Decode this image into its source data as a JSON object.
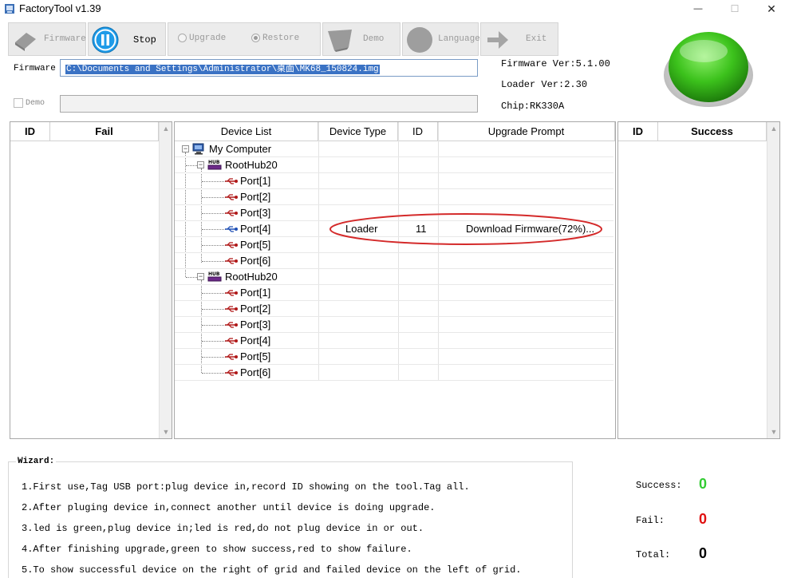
{
  "window": {
    "title": "FactoryTool v1.39",
    "minimize": "—",
    "maximize": "☐",
    "close": "✕"
  },
  "toolbar": {
    "firmware": "Firmware",
    "stop": "Stop",
    "upgrade": "Upgrade",
    "restore": "Restore",
    "demo": "Demo",
    "language": "Language",
    "exit": "Exit"
  },
  "firmware": {
    "label": "Firmware",
    "path": "C:\\Documents and Settings\\Administrator\\桌面\\MK68_150824.img"
  },
  "demo": {
    "label": "Demo",
    "path": ""
  },
  "info": {
    "fw_ver": "Firmware Ver:5.1.00",
    "loader_ver": "Loader Ver:2.30",
    "chip": "Chip:RK330A"
  },
  "status_led": {
    "color": "#3cc21c"
  },
  "fail_grid": {
    "id": "ID",
    "title": "Fail"
  },
  "success_grid": {
    "id": "ID",
    "title": "Success"
  },
  "device_grid": {
    "headers": [
      "Device List",
      "Device Type",
      "ID",
      "Upgrade Prompt"
    ],
    "root": "My Computer",
    "hubs": [
      {
        "name": "RootHub20",
        "ports": [
          "Port[1]",
          "Port[2]",
          "Port[3]",
          "Port[4]",
          "Port[5]",
          "Port[6]"
        ]
      },
      {
        "name": "RootHub20",
        "ports": [
          "Port[1]",
          "Port[2]",
          "Port[3]",
          "Port[4]",
          "Port[5]",
          "Port[6]"
        ]
      }
    ],
    "active": {
      "type": "Loader",
      "id": "11",
      "prompt": "Download Firmware(72%)..."
    }
  },
  "wizard": {
    "title": "Wizard:",
    "lines": [
      "1.First use,Tag USB port:plug device in,record ID showing on the tool.Tag all.",
      "2.After pluging device in,connect another until device is doing upgrade.",
      "3.led is green,plug device in;led is red,do not plug device in or out.",
      "4.After finishing upgrade,green to show success,red to show failure.",
      "5.To show successful device on the right of grid and failed device on the left of grid."
    ]
  },
  "stats": {
    "success_label": "Success:",
    "success": "0",
    "fail_label": "Fail:",
    "fail": "0",
    "total_label": "Total:",
    "total": "0",
    "colors": {
      "success": "#33cc33",
      "fail": "#e01010",
      "total": "#000000"
    }
  }
}
